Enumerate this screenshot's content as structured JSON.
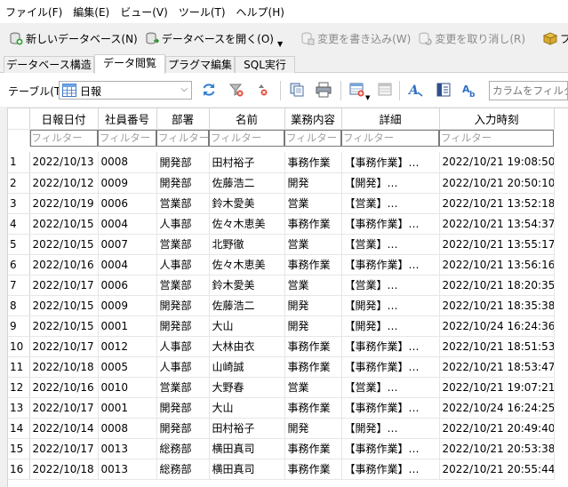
{
  "menu": [
    "ファイル(F)",
    "編集(E)",
    "ビュー(V)",
    "ツール(T)",
    "ヘルプ(H)"
  ],
  "toolbar": {
    "new_db": "新しいデータベース(N)",
    "open_db": "データベースを開く(O)",
    "write_changes": "変更を書き込み(W)",
    "revert_changes": "変更を取り消し(R)",
    "project": "プロジ"
  },
  "tabs": [
    "データベース構造",
    "データ閲覧",
    "プラグマ編集",
    "SQL実行"
  ],
  "browse": {
    "table_label": "テーブル(T):",
    "table_value": "日報",
    "column_filter_placeholder": "カラムをフィルター"
  },
  "grid": {
    "columns": [
      "日報日付",
      "社員番号",
      "部署",
      "名前",
      "業務内容",
      "詳細",
      "入力時刻"
    ],
    "filter_placeholder": "フィルター",
    "rows": [
      [
        "1",
        "2022/10/13",
        "0008",
        "開発部",
        "田村裕子",
        "事務作業",
        "【事務作業】…",
        "2022/10/21 19:08:50"
      ],
      [
        "2",
        "2022/10/12",
        "0009",
        "開発部",
        "佐藤浩二",
        "開発",
        "【開発】…",
        "2022/10/21 20:50:10"
      ],
      [
        "3",
        "2022/10/19",
        "0006",
        "営業部",
        "鈴木愛美",
        "営業",
        "【営業】…",
        "2022/10/21 13:52:18"
      ],
      [
        "4",
        "2022/10/15",
        "0004",
        "人事部",
        "佐々木恵美",
        "事務作業",
        "【事務作業】…",
        "2022/10/21 13:54:37"
      ],
      [
        "5",
        "2022/10/15",
        "0007",
        "営業部",
        "北野徹",
        "営業",
        "【営業】…",
        "2022/10/21 13:55:17"
      ],
      [
        "6",
        "2022/10/16",
        "0004",
        "人事部",
        "佐々木恵美",
        "事務作業",
        "【事務作業】…",
        "2022/10/21 13:56:16"
      ],
      [
        "7",
        "2022/10/17",
        "0006",
        "営業部",
        "鈴木愛美",
        "営業",
        "【営業】…",
        "2022/10/21 18:20:35"
      ],
      [
        "8",
        "2022/10/15",
        "0009",
        "開発部",
        "佐藤浩二",
        "開発",
        "【開発】…",
        "2022/10/21 18:35:38"
      ],
      [
        "9",
        "2022/10/15",
        "0001",
        "開発部",
        "大山",
        "開発",
        "【開発】…",
        "2022/10/24 16:24:36"
      ],
      [
        "10",
        "2022/10/17",
        "0012",
        "人事部",
        "大林由衣",
        "事務作業",
        "【事務作業】…",
        "2022/10/21 18:51:53"
      ],
      [
        "11",
        "2022/10/18",
        "0005",
        "人事部",
        "山崎誠",
        "事務作業",
        "【事務作業】…",
        "2022/10/21 18:53:47"
      ],
      [
        "12",
        "2022/10/16",
        "0010",
        "営業部",
        "大野春",
        "営業",
        "【営業】…",
        "2022/10/21 19:07:21"
      ],
      [
        "13",
        "2022/10/17",
        "0001",
        "開発部",
        "大山",
        "事務作業",
        "【事務作業】…",
        "2022/10/24 16:24:25"
      ],
      [
        "14",
        "2022/10/14",
        "0008",
        "開発部",
        "田村裕子",
        "開発",
        "【開発】…",
        "2022/10/21 20:49:40"
      ],
      [
        "15",
        "2022/10/17",
        "0013",
        "総務部",
        "横田真司",
        "事務作業",
        "【事務作業】…",
        "2022/10/21 20:53:38"
      ],
      [
        "16",
        "2022/10/18",
        "0013",
        "総務部",
        "横田真司",
        "事務作業",
        "【事務作業】…",
        "2022/10/21 20:55:44"
      ]
    ]
  },
  "icons": [
    "new-database-icon",
    "open-database-icon",
    "write-changes-icon",
    "revert-changes-icon",
    "project-icon",
    "table-icon",
    "refresh-icon",
    "clear-filters-icon",
    "sort-icon",
    "copy-icon",
    "print-icon",
    "insert-record-icon",
    "delete-record-icon",
    "font-icon",
    "column-settings-icon",
    "find-replace-icon"
  ]
}
